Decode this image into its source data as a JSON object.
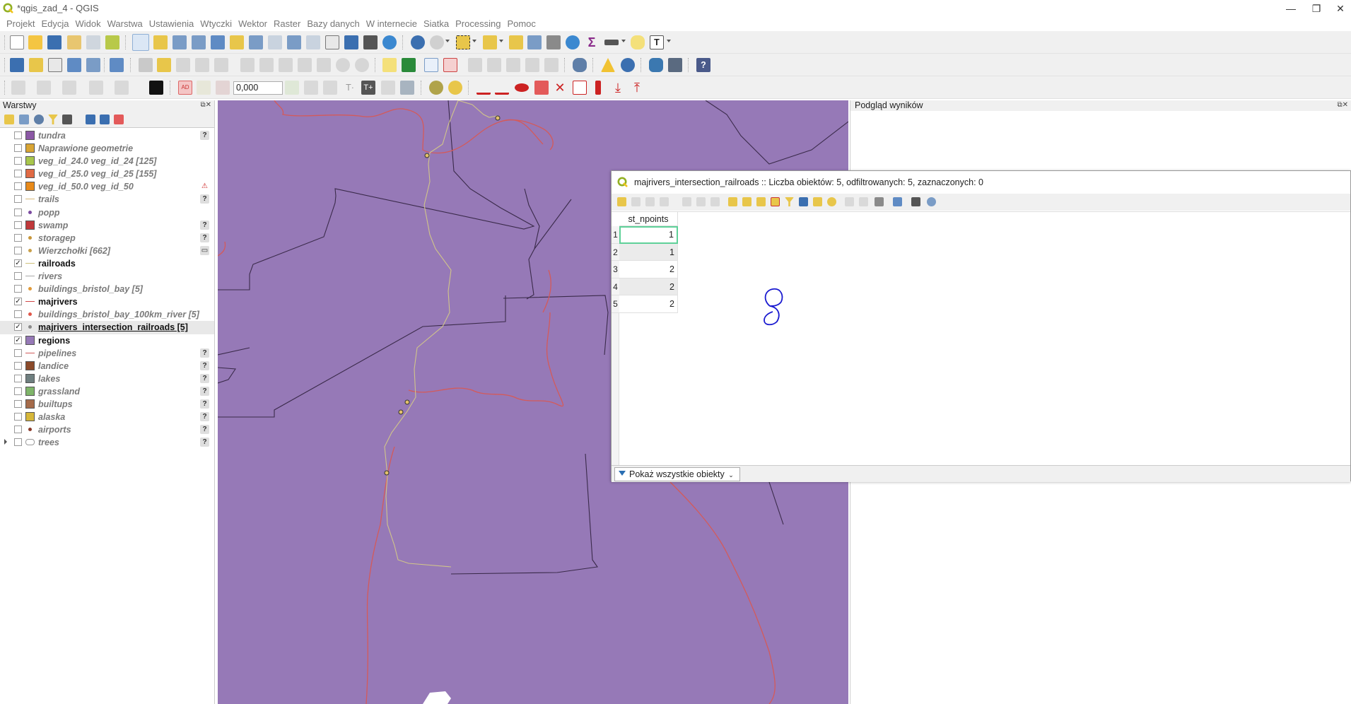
{
  "window": {
    "title": "*qgis_zad_4 - QGIS",
    "minimize": "—",
    "restore": "❐",
    "close": "✕"
  },
  "menu": [
    "Projekt",
    "Edycja",
    "Widok",
    "Warstwa",
    "Ustawienia",
    "Wtyczki",
    "Wektor",
    "Raster",
    "Bazy danych",
    "W internecie",
    "Siatka",
    "Processing",
    "Pomoc"
  ],
  "toolbar3": {
    "value_field": "0,000"
  },
  "layers_panel": {
    "title": "Warstwy",
    "layers": [
      {
        "name": "tundra",
        "checked": false,
        "symbol": "fill",
        "color": "#8b58a5",
        "indicator": "?"
      },
      {
        "name": "Naprawione geometrie",
        "checked": false,
        "symbol": "fill",
        "color": "#d9a534",
        "indicator": ""
      },
      {
        "name": "veg_id_24.0 veg_id_24 [125]",
        "checked": false,
        "symbol": "fill",
        "color": "#a8c64c",
        "indicator": ""
      },
      {
        "name": "veg_id_25.0 veg_id_25 [155]",
        "checked": false,
        "symbol": "fill",
        "color": "#e06a44",
        "indicator": ""
      },
      {
        "name": "veg_id_50.0 veg_id_50",
        "checked": false,
        "symbol": "fill",
        "color": "#e88a1a",
        "indicator": "⚠"
      },
      {
        "name": "trails",
        "checked": false,
        "symbol": "line",
        "color": "#d8b978",
        "indicator": "?"
      },
      {
        "name": "popp",
        "checked": false,
        "symbol": "point",
        "color": "#7b4aa0",
        "indicator": ""
      },
      {
        "name": "swamp",
        "checked": false,
        "symbol": "fill",
        "color": "#c0393b",
        "indicator": "?"
      },
      {
        "name": "storagep",
        "checked": false,
        "symbol": "point",
        "color": "#c7963a",
        "indicator": "?"
      },
      {
        "name": "Wierzchołki [662]",
        "checked": false,
        "symbol": "point",
        "color": "#c9a04a",
        "indicator": "▭"
      },
      {
        "name": "railroads",
        "checked": true,
        "symbol": "line",
        "color": "#cfc07a",
        "indicator": ""
      },
      {
        "name": "rivers",
        "checked": false,
        "symbol": "line",
        "color": "#a9a9a9",
        "indicator": ""
      },
      {
        "name": "buildings_bristol_bay [5]",
        "checked": false,
        "symbol": "point",
        "color": "#e09a3a",
        "indicator": ""
      },
      {
        "name": "majrivers",
        "checked": true,
        "symbol": "line",
        "color": "#d04848",
        "indicator": ""
      },
      {
        "name": "buildings_bristol_bay_100km_river [5]",
        "checked": false,
        "symbol": "point",
        "color": "#e0574a",
        "indicator": ""
      },
      {
        "name": "majrivers_intersection_railroads [5]",
        "checked": true,
        "symbol": "point",
        "color": "#8a8a8a",
        "indicator": "",
        "selected": true
      },
      {
        "name": "regions",
        "checked": true,
        "symbol": "fill",
        "color": "#9679b7",
        "indicator": ""
      },
      {
        "name": "pipelines",
        "checked": false,
        "symbol": "line",
        "color": "#d05a5a",
        "indicator": "?"
      },
      {
        "name": "landice",
        "checked": false,
        "symbol": "fill",
        "color": "#8b4a2a",
        "indicator": "?"
      },
      {
        "name": "lakes",
        "checked": false,
        "symbol": "fill",
        "color": "#6f7f80",
        "indicator": "?"
      },
      {
        "name": "grassland",
        "checked": false,
        "symbol": "fill",
        "color": "#7fb56a",
        "indicator": "?"
      },
      {
        "name": "builtups",
        "checked": false,
        "symbol": "fill",
        "color": "#a56b4a",
        "indicator": "?"
      },
      {
        "name": "alaska",
        "checked": false,
        "symbol": "fill",
        "color": "#d6b73a",
        "indicator": "?"
      },
      {
        "name": "airports",
        "checked": false,
        "symbol": "point",
        "color": "#8a3a2a",
        "indicator": "?"
      },
      {
        "name": "trees",
        "checked": false,
        "symbol": "group",
        "color": "#9a9a9a",
        "indicator": "?",
        "expandable": true
      }
    ]
  },
  "results_panel": {
    "title": "Podgląd wyników"
  },
  "attribute_table": {
    "title": "majrivers_intersection_railroads :: Liczba obiektów: 5, odfiltrowanych: 5, zaznaczonych: 0",
    "column": "st_npoints",
    "rows": [
      {
        "id": "1",
        "value": "1"
      },
      {
        "id": "2",
        "value": "1"
      },
      {
        "id": "3",
        "value": "2"
      },
      {
        "id": "4",
        "value": "2"
      },
      {
        "id": "5",
        "value": "2"
      }
    ],
    "filter_button": "Pokaż wszystkie obiekty"
  }
}
